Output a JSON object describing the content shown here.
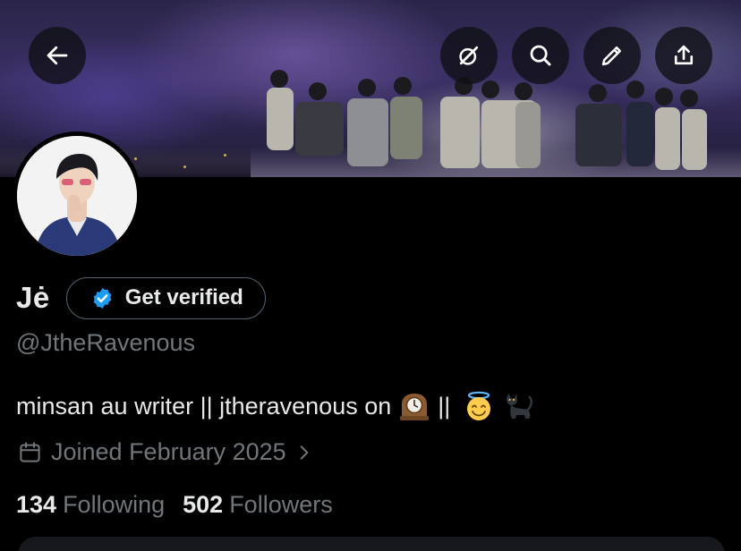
{
  "header": {
    "back_icon": "arrow-left-icon",
    "grok_icon": "grok-icon",
    "search_icon": "search-icon",
    "edit_icon": "pencil-icon",
    "share_icon": "share-icon"
  },
  "profile": {
    "display_name": "Jė",
    "verify_label": "Get verified",
    "handle": "@JtheRavenous",
    "bio_text": "minsan au writer || jtheravenous on",
    "bio_separator": "||",
    "bio_emojis": [
      "mantelpiece-clock-emoji",
      "smiling-face-with-halo-emoji",
      "black-cat-emoji"
    ],
    "joined": "Joined February 2025",
    "following_count": "134",
    "following_label": "Following",
    "followers_count": "502",
    "followers_label": "Followers"
  },
  "colors": {
    "background": "#000000",
    "primary_text": "#e7e9ea",
    "secondary_text": "#71767b",
    "verified_badge": "#1d9bf0",
    "button_border": "#536471"
  }
}
